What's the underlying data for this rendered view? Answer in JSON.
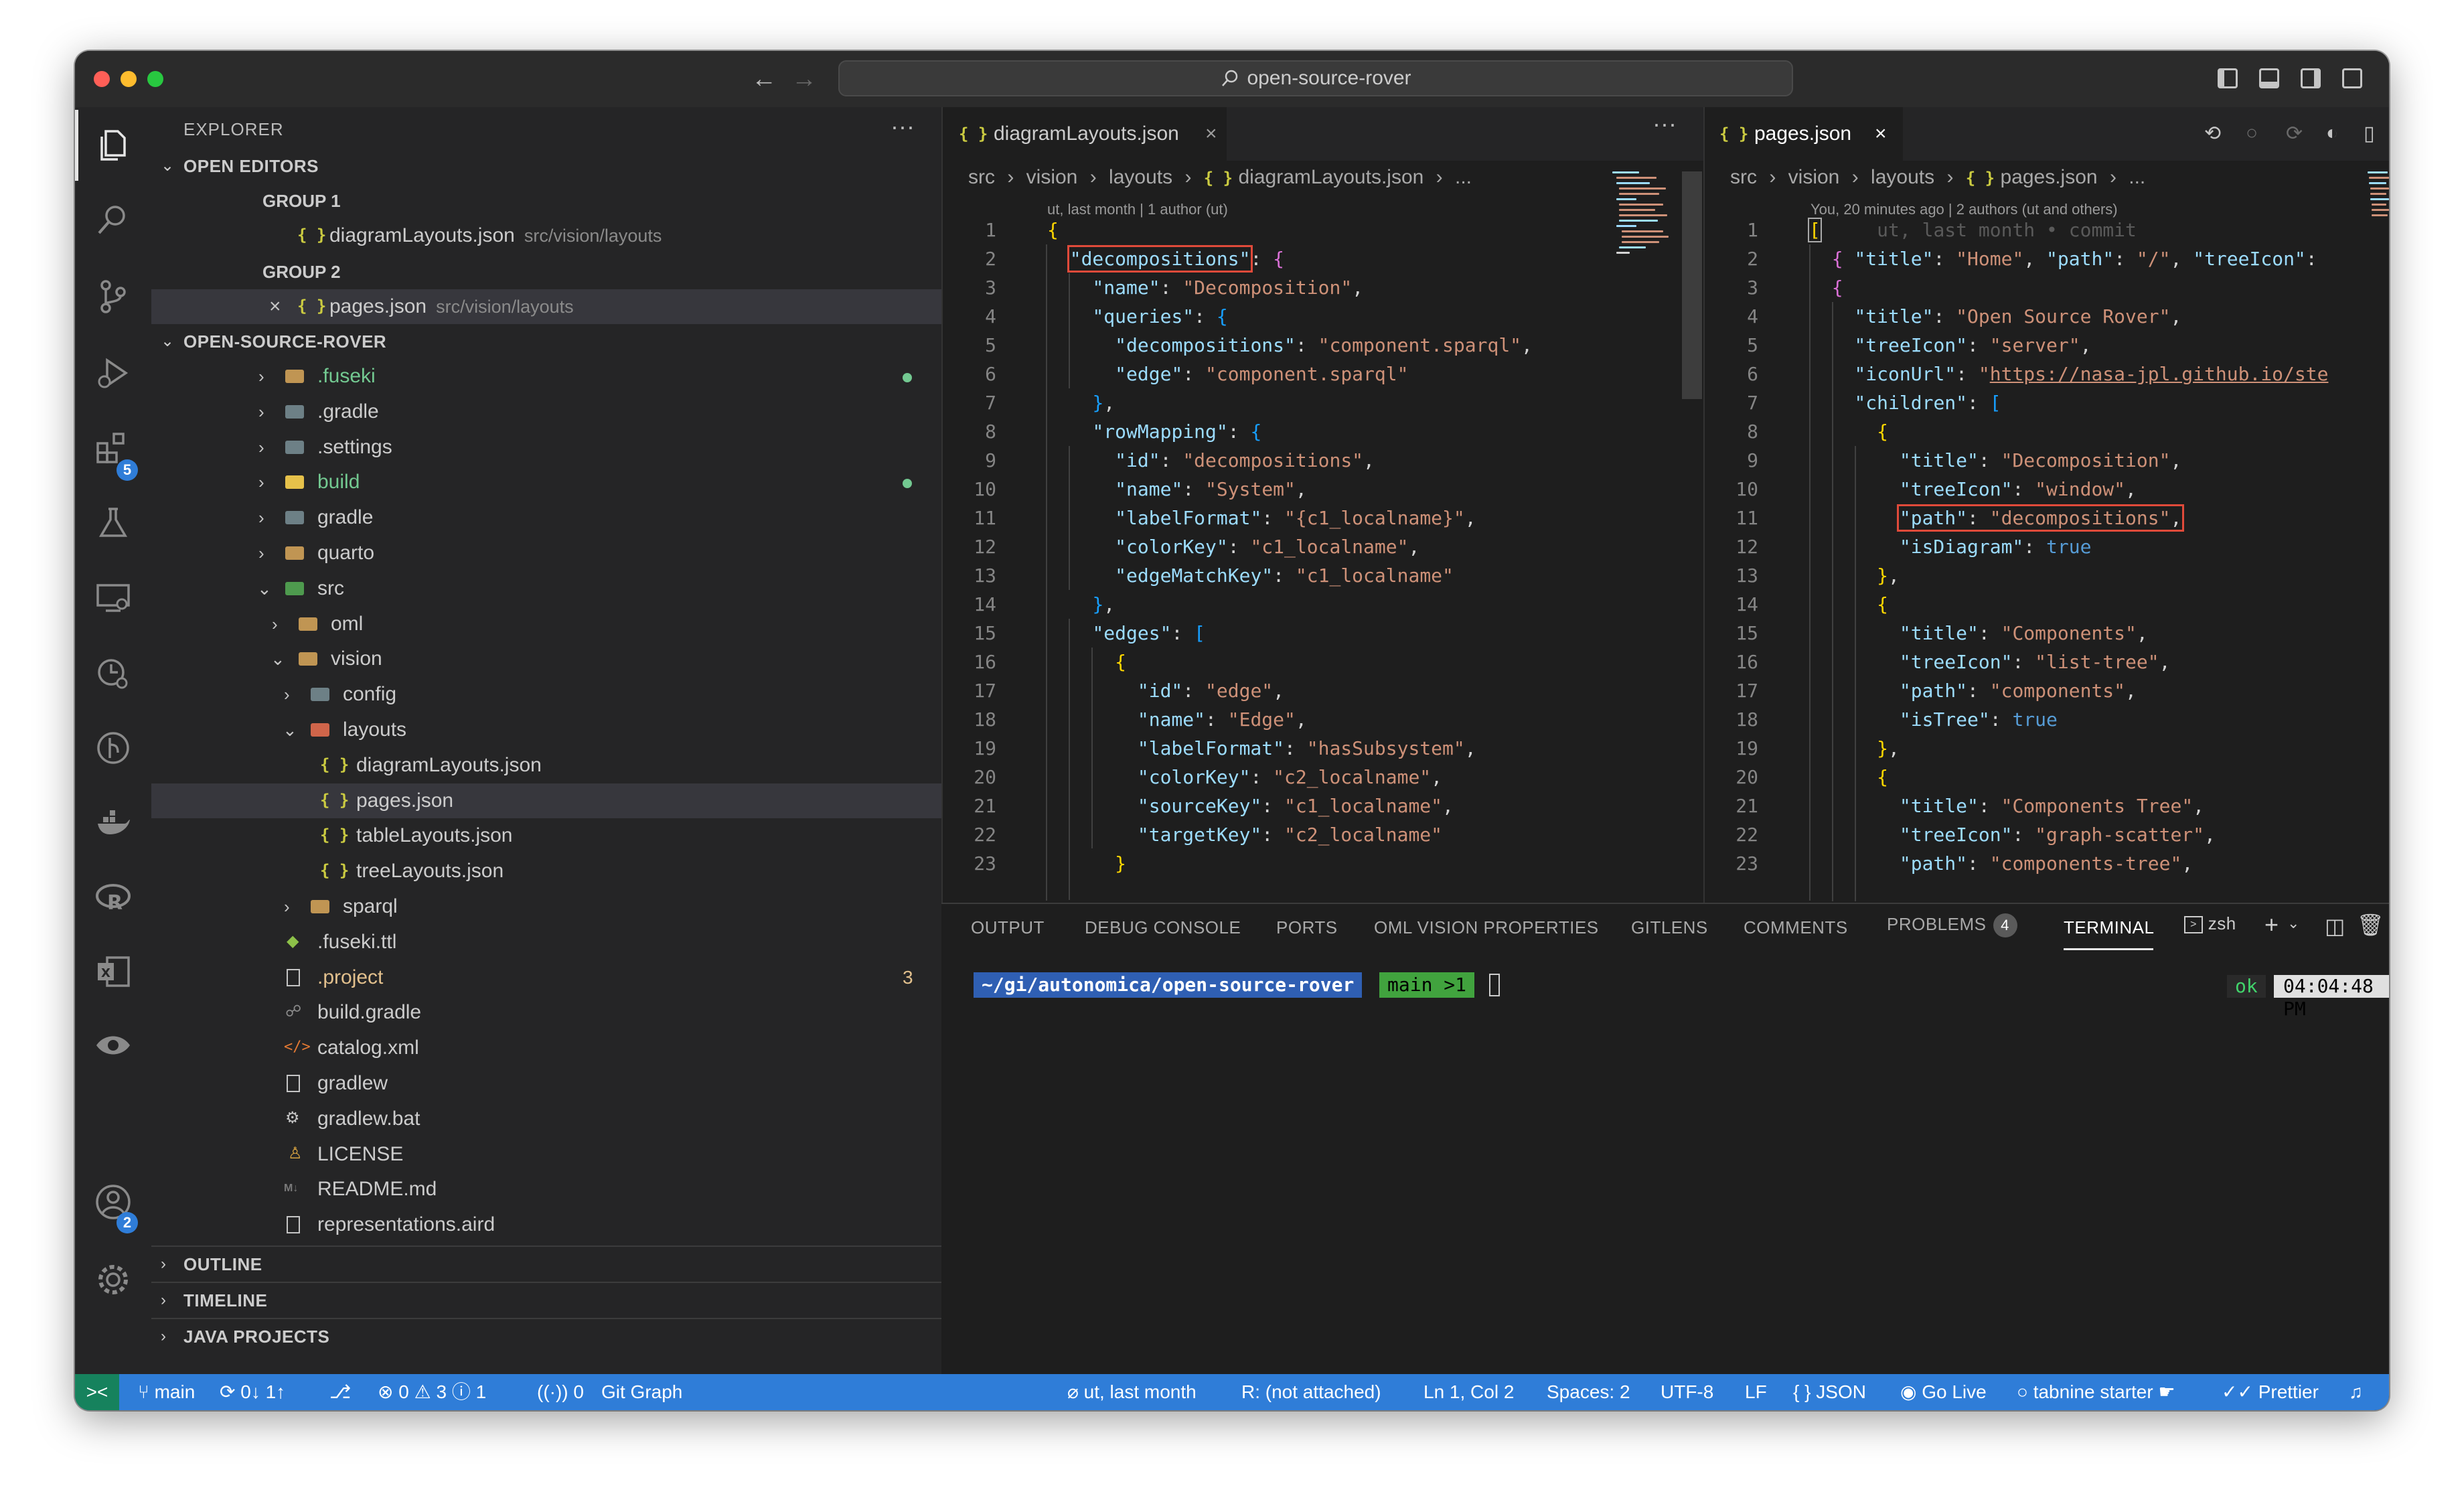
{
  "window": {
    "title": "open-source-rover"
  },
  "activity_bar": {
    "extensions_badge": "5",
    "accounts_badge": "2"
  },
  "explorer": {
    "title": "EXPLORER",
    "more": "···",
    "open_editors": {
      "header": "OPEN EDITORS",
      "group1": "GROUP 1",
      "group1_file": "diagramLayouts.json",
      "group1_path": "src/vision/layouts",
      "group2": "GROUP 2",
      "group2_file": "pages.json",
      "group2_path": "src/vision/layouts"
    },
    "project_header": "OPEN-SOURCE-ROVER",
    "tree": [
      {
        "name": ".fuseki",
        "color": "#73c991",
        "dot": true
      },
      {
        "name": ".gradle",
        "color": "#cccccc"
      },
      {
        "name": ".settings",
        "color": "#cccccc"
      },
      {
        "name": "build",
        "color": "#73c991",
        "dot": true
      },
      {
        "name": "gradle",
        "color": "#cccccc"
      },
      {
        "name": "quarto",
        "color": "#cccccc"
      },
      {
        "name": "src",
        "color": "#cccccc"
      },
      {
        "name": "oml",
        "color": "#cccccc"
      },
      {
        "name": "vision",
        "color": "#cccccc"
      },
      {
        "name": "config",
        "color": "#cccccc"
      },
      {
        "name": "layouts",
        "color": "#cccccc"
      },
      {
        "name": "diagramLayouts.json",
        "color": "#cccccc"
      },
      {
        "name": "pages.json",
        "color": "#cccccc"
      },
      {
        "name": "tableLayouts.json",
        "color": "#cccccc"
      },
      {
        "name": "treeLayouts.json",
        "color": "#cccccc"
      },
      {
        "name": "sparql",
        "color": "#cccccc"
      },
      {
        "name": ".fuseki.ttl",
        "color": "#cccccc"
      },
      {
        "name": ".project",
        "color": "#e2c08d",
        "count": "3"
      },
      {
        "name": "build.gradle",
        "color": "#cccccc"
      },
      {
        "name": "catalog.xml",
        "color": "#cccccc"
      },
      {
        "name": "gradlew",
        "color": "#cccccc"
      },
      {
        "name": "gradlew.bat",
        "color": "#cccccc"
      },
      {
        "name": "LICENSE",
        "color": "#cccccc"
      },
      {
        "name": "README.md",
        "color": "#cccccc"
      },
      {
        "name": "representations.aird",
        "color": "#cccccc"
      }
    ],
    "outline": "OUTLINE",
    "timeline": "TIMELINE",
    "java_projects": "JAVA PROJECTS"
  },
  "editor_left": {
    "tab": "diagramLayouts.json",
    "breadcrumb": [
      "src",
      "vision",
      "layouts",
      "diagramLayouts.json",
      "..."
    ],
    "blame": "ut, last month | 1 author (ut)",
    "line_numbers": [
      "1",
      "2",
      "3",
      "4",
      "5",
      "6",
      "7",
      "8",
      "9",
      "10",
      "11",
      "12",
      "13",
      "14",
      "15",
      "16",
      "17",
      "18",
      "19",
      "20",
      "21",
      "22",
      "23"
    ]
  },
  "editor_right": {
    "tab": "pages.json",
    "breadcrumb": [
      "src",
      "vision",
      "layouts",
      "pages.json",
      "..."
    ],
    "blame": "You, 20 minutes ago | 2 authors (ut and others)",
    "ghost": "ut, last month • commit",
    "line_numbers": [
      "1",
      "2",
      "3",
      "4",
      "5",
      "6",
      "7",
      "8",
      "9",
      "10",
      "11",
      "12",
      "13",
      "14",
      "15",
      "16",
      "17",
      "18",
      "19",
      "20",
      "21",
      "22",
      "23"
    ]
  },
  "panel": {
    "tabs": [
      "OUTPUT",
      "DEBUG CONSOLE",
      "PORTS",
      "OML VISION PROPERTIES",
      "GITLENS",
      "COMMENTS",
      "PROBLEMS",
      "TERMINAL"
    ],
    "problems_count": "4",
    "shell": "zsh",
    "prompt_path": "~/gi/autonomica/open-source-rover",
    "prompt_branch": "main >1",
    "prompt_ok": "ok",
    "prompt_time": "04:04:48 PM"
  },
  "status_bar": {
    "branch": "main",
    "sync": "0↓ 1↑",
    "errors": "0",
    "warnings": "3",
    "infos": "1",
    "ports": "0",
    "git_graph": "Git Graph",
    "blame": "ut, last month",
    "repl": "R: (not attached)",
    "cursor": "Ln 1, Col 2",
    "spaces": "Spaces: 2",
    "encoding": "UTF-8",
    "eol": "LF",
    "language": "JSON",
    "go_live": "Go Live",
    "tabnine": "tabnine starter",
    "prettier": "Prettier"
  }
}
